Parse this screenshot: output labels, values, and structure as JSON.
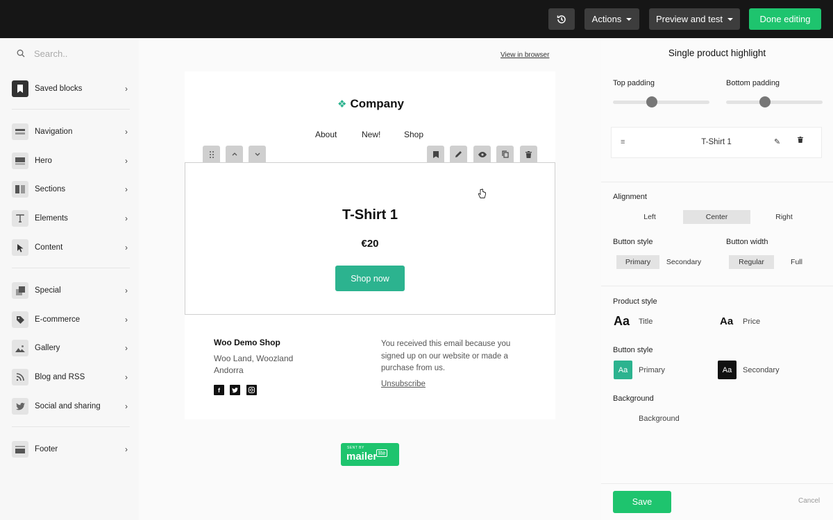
{
  "topbar": {
    "actions_label": "Actions",
    "preview_label": "Preview and test",
    "done_label": "Done editing"
  },
  "sidebar": {
    "search_placeholder": "Search..",
    "items": [
      {
        "label": "Saved blocks",
        "icon": "bookmark-icon"
      },
      {
        "label": "Navigation",
        "icon": "navigation-icon"
      },
      {
        "label": "Hero",
        "icon": "hero-icon"
      },
      {
        "label": "Sections",
        "icon": "sections-icon"
      },
      {
        "label": "Elements",
        "icon": "text-icon"
      },
      {
        "label": "Content",
        "icon": "cursor-icon"
      },
      {
        "label": "Special",
        "icon": "special-icon"
      },
      {
        "label": "E-commerce",
        "icon": "tag-icon"
      },
      {
        "label": "Gallery",
        "icon": "image-icon"
      },
      {
        "label": "Blog and RSS",
        "icon": "rss-icon"
      },
      {
        "label": "Social and sharing",
        "icon": "twitter-icon"
      },
      {
        "label": "Footer",
        "icon": "footer-icon"
      }
    ]
  },
  "email": {
    "view_in_browser": "View in browser",
    "logo_text": "Company",
    "nav": [
      "About",
      "New!",
      "Shop"
    ],
    "product": {
      "title": "T-Shirt 1",
      "price": "€20",
      "button": "Shop now"
    },
    "footer": {
      "shop_name": "Woo Demo Shop",
      "address_line1": "Woo Land, Woozland",
      "address_line2": "Andorra",
      "note": "You received this email because you signed up on our website or made a purchase from us.",
      "unsubscribe": "Unsubscribe"
    },
    "badge": {
      "sent_by": "SENT BY",
      "brand": "mailer",
      "lite": "lite"
    }
  },
  "panel": {
    "title": "Single product highlight",
    "top_padding_label": "Top padding",
    "bottom_padding_label": "Bottom padding",
    "top_padding_level": 0.4,
    "bottom_padding_level": 0.4,
    "item_name": "T-Shirt 1",
    "alignment_label": "Alignment",
    "alignment_options": [
      "Left",
      "Center",
      "Right"
    ],
    "alignment_selected": "Center",
    "button_style_label": "Button style",
    "button_style_options": [
      "Primary",
      "Secondary"
    ],
    "button_style_selected": "Primary",
    "button_width_label": "Button width",
    "button_width_options": [
      "Regular",
      "Full"
    ],
    "button_width_selected": "Regular",
    "product_style_label": "Product style",
    "aa_glyph": "Aa",
    "title_style_label": "Title",
    "price_style_label": "Price",
    "button_style2_label": "Button style",
    "primary_label": "Primary",
    "secondary_label": "Secondary",
    "background_label": "Background",
    "background_option": "Background",
    "save_label": "Save",
    "cancel_label": "Cancel"
  },
  "colors": {
    "topbar_bg": "#161616",
    "green": "#1ec46e",
    "teal": "#2cb38f",
    "secondary_swatch": "#111111"
  }
}
